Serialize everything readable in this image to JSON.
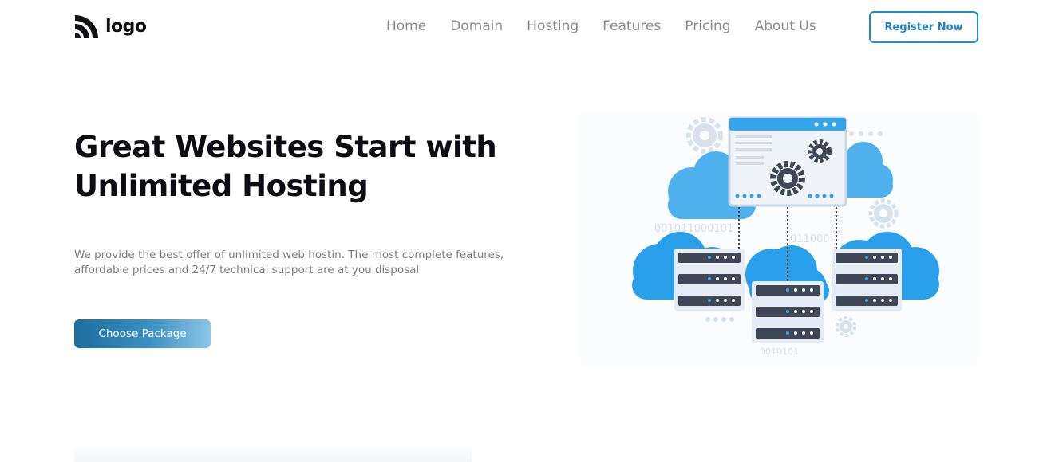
{
  "header": {
    "logo_text": "logo",
    "nav": [
      {
        "label": "Home"
      },
      {
        "label": "Domain"
      },
      {
        "label": "Hosting"
      },
      {
        "label": "Features"
      },
      {
        "label": "Pricing"
      },
      {
        "label": "About Us"
      }
    ],
    "register_label": "Register Now"
  },
  "hero": {
    "title_line1": "Great Websites Start with",
    "title_line2": "Unlimited Hosting",
    "desc_line1": "We provide the best offer of unlimited web hostin. The most complete features,",
    "desc_line2": "affordable prices and 24/7 technical support are at you disposal",
    "cta_label": "Choose Package"
  },
  "illustration": {
    "binary_texts": [
      "001011000101",
      "0101",
      "011000",
      "0010101"
    ]
  },
  "colors": {
    "accent": "#1f8ecf",
    "cloud": "#35a4ea",
    "server_dark": "#3f4757",
    "gear": "#d9e2ec"
  }
}
